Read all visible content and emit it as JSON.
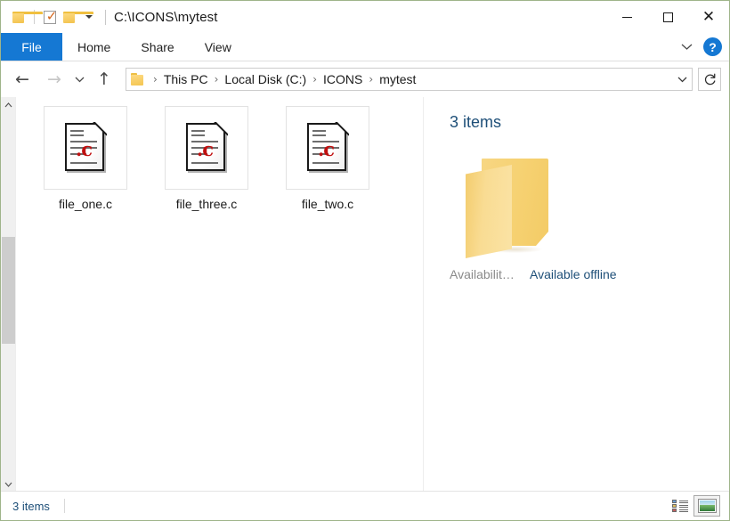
{
  "window": {
    "title": "C:\\ICONS\\mytest",
    "quick_access": [
      {
        "name": "folder-icon",
        "label": "Folder"
      },
      {
        "name": "properties-icon",
        "label": "Properties"
      },
      {
        "name": "new-folder-icon",
        "label": "New folder"
      },
      {
        "name": "customize-caret-icon",
        "label": "Customize Quick Access Toolbar"
      }
    ],
    "controls": {
      "minimize": "—",
      "maximize": "□",
      "close": "✕"
    }
  },
  "ribbon": {
    "tabs": [
      {
        "label": "File",
        "active": true
      },
      {
        "label": "Home",
        "active": false
      },
      {
        "label": "Share",
        "active": false
      },
      {
        "label": "View",
        "active": false
      }
    ],
    "collapse_icon": "⌄",
    "help_label": "?"
  },
  "navigation": {
    "back_icon": "←",
    "forward_icon": "→",
    "recent_icon": "⌄",
    "up_icon": "↑",
    "refresh_icon": "↻",
    "address_caret": "⌄",
    "breadcrumbs": [
      "This PC",
      "Local Disk (C:)",
      "ICONS",
      "mytest"
    ],
    "separator": "›"
  },
  "files": [
    {
      "name": "file_one.c",
      "icon": "c-source-file-icon",
      "ext": ".c"
    },
    {
      "name": "file_three.c",
      "icon": "c-source-file-icon",
      "ext": ".c"
    },
    {
      "name": "file_two.c",
      "icon": "c-source-file-icon",
      "ext": ".c"
    }
  ],
  "details_pane": {
    "heading": "3 items",
    "folder_icon": "folder-icon",
    "properties": [
      {
        "key": "Availabilit…",
        "value": "Available offline"
      }
    ]
  },
  "status_bar": {
    "item_count": "3 items",
    "views": [
      {
        "name": "details-view-button",
        "active": false
      },
      {
        "name": "large-icons-view-button",
        "active": true
      }
    ]
  },
  "colors": {
    "accent": "#1578d3",
    "detail_text": "#1e4f78",
    "folder_yellow": "#f6d171",
    "c_red": "#c01010",
    "window_border": "#9fb48a"
  }
}
